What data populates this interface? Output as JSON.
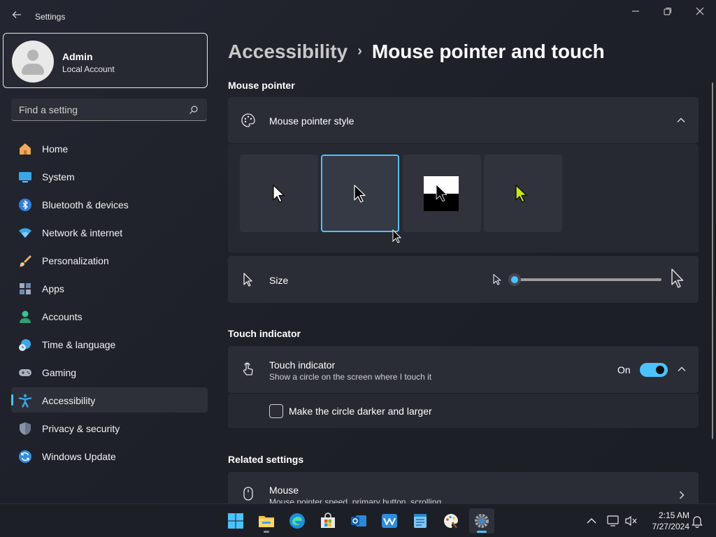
{
  "window": {
    "title": "Settings",
    "accent_color": "#4cc2ff"
  },
  "profile": {
    "name": "Admin",
    "account_type": "Local Account"
  },
  "search": {
    "placeholder": "Find a setting"
  },
  "sidebar": {
    "items": [
      {
        "label": "Home",
        "icon": "home-icon"
      },
      {
        "label": "System",
        "icon": "system-icon"
      },
      {
        "label": "Bluetooth & devices",
        "icon": "bluetooth-icon"
      },
      {
        "label": "Network & internet",
        "icon": "wifi-icon"
      },
      {
        "label": "Personalization",
        "icon": "brush-icon"
      },
      {
        "label": "Apps",
        "icon": "apps-icon"
      },
      {
        "label": "Accounts",
        "icon": "accounts-icon"
      },
      {
        "label": "Time & language",
        "icon": "time-language-icon"
      },
      {
        "label": "Gaming",
        "icon": "gamepad-icon"
      },
      {
        "label": "Accessibility",
        "icon": "accessibility-icon",
        "active": true
      },
      {
        "label": "Privacy & security",
        "icon": "shield-icon"
      },
      {
        "label": "Windows Update",
        "icon": "update-icon"
      }
    ]
  },
  "breadcrumb": {
    "parent": "Accessibility",
    "separator": "›",
    "current": "Mouse pointer and touch"
  },
  "mouse_pointer": {
    "section_title": "Mouse pointer",
    "style_label": "Mouse pointer style",
    "styles": [
      {
        "name": "white",
        "selected": false
      },
      {
        "name": "black",
        "selected": true
      },
      {
        "name": "inverted",
        "selected": false
      },
      {
        "name": "custom",
        "selected": false,
        "color": "#c8e619"
      }
    ],
    "size_label": "Size",
    "size_value": 0.0
  },
  "touch_indicator": {
    "section_title": "Touch indicator",
    "label": "Touch indicator",
    "description": "Show a circle on the screen where I touch it",
    "state_label": "On",
    "enabled": true,
    "darker_larger_label": "Make the circle darker and larger",
    "darker_larger_checked": false
  },
  "related": {
    "section_title": "Related settings",
    "mouse_label": "Mouse",
    "mouse_description": "Mouse pointer speed, primary button, scrolling"
  },
  "taskbar": {
    "apps": [
      "start-icon",
      "file-explorer-icon",
      "edge-icon",
      "store-icon",
      "outlook-icon",
      "whiteboard-icon",
      "notepad-icon",
      "paint-icon",
      "settings-icon"
    ],
    "time": "2:15 AM",
    "date": "7/27/2024"
  }
}
